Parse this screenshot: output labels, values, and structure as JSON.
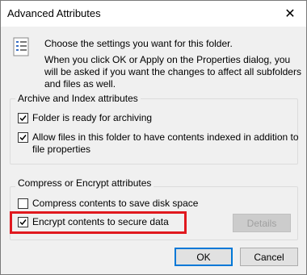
{
  "window": {
    "title": "Advanced Attributes"
  },
  "intro": {
    "heading": "Choose the settings you want for this folder.",
    "description": "When you click OK or Apply on the Properties dialog, you will be asked if you want the changes to affect all subfolders and files as well."
  },
  "archive_group": {
    "title": "Archive and Index attributes",
    "options": [
      {
        "label": "Folder is ready for archiving",
        "checked": true
      },
      {
        "label": "Allow files in this folder to have contents indexed in addition to file properties",
        "checked": true
      }
    ]
  },
  "compress_group": {
    "title": "Compress or Encrypt attributes",
    "options": [
      {
        "label": "Compress contents to save disk space",
        "checked": false
      },
      {
        "label": "Encrypt contents to secure data",
        "checked": true
      }
    ],
    "details_label": "Details"
  },
  "buttons": {
    "ok": "OK",
    "cancel": "Cancel"
  },
  "colors": {
    "highlight": "#e0181e",
    "accent": "#0078d7"
  }
}
